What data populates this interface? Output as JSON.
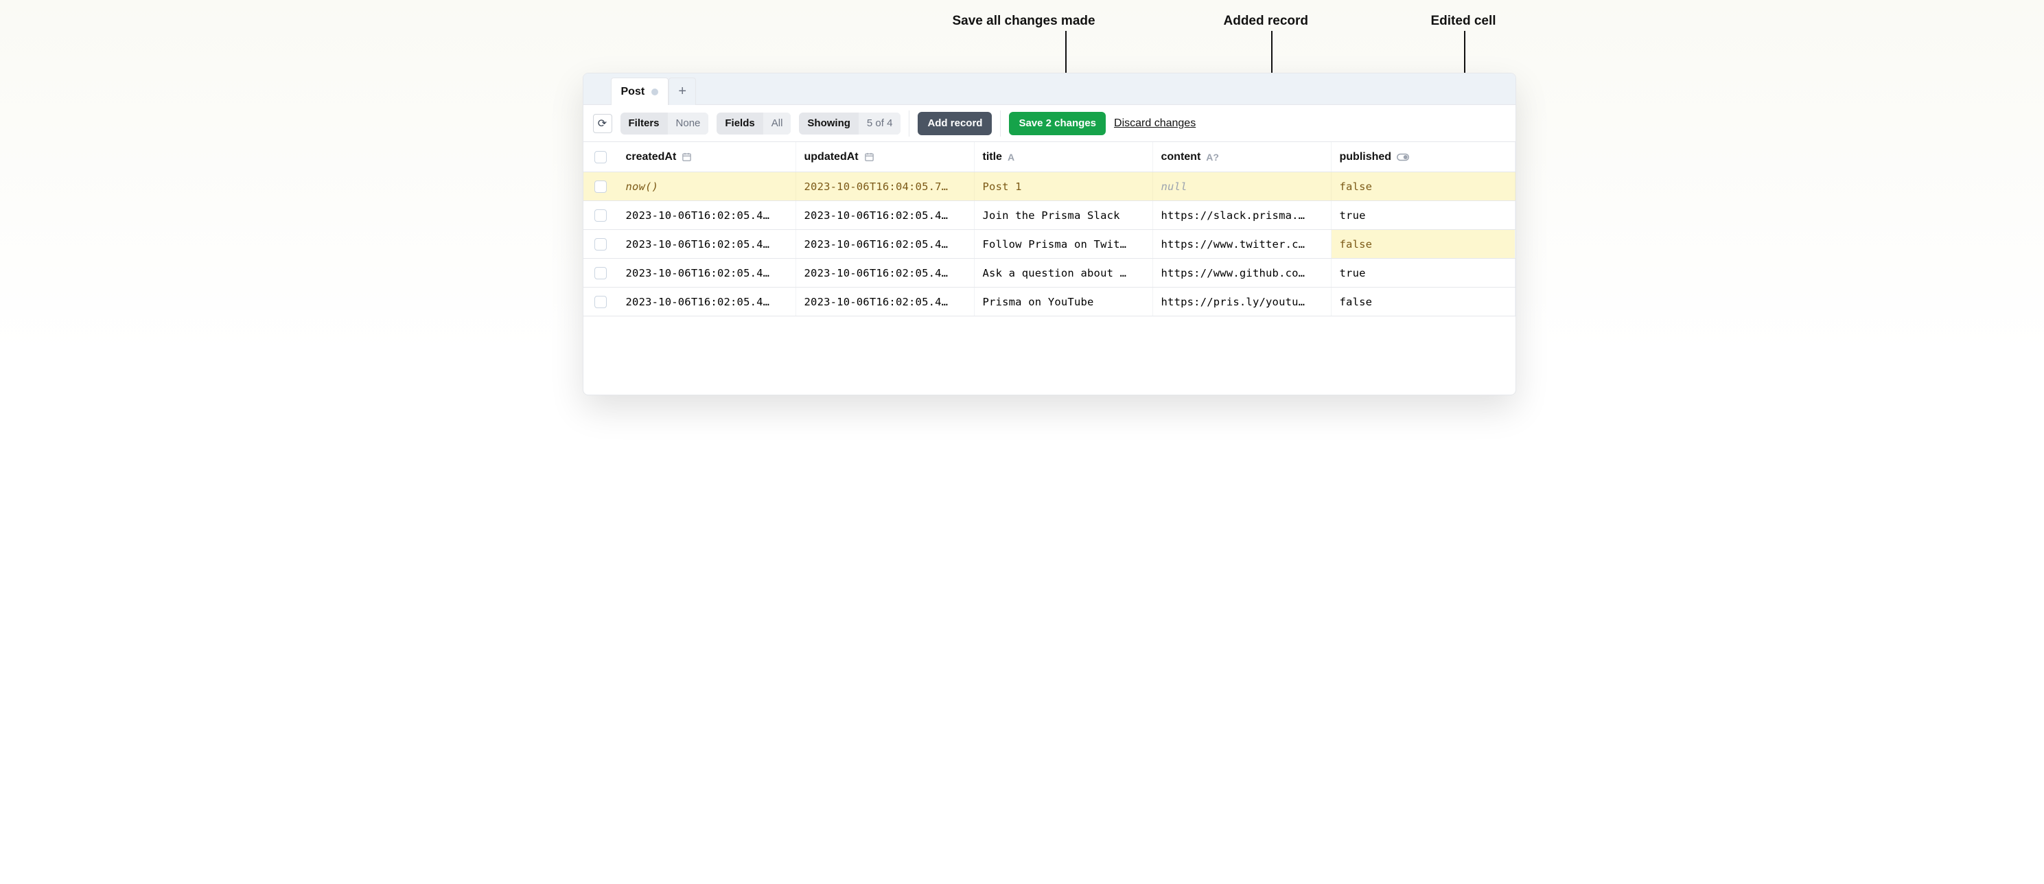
{
  "annotations": {
    "save": "Save all changes made",
    "added": "Added record",
    "edited": "Edited cell"
  },
  "tabs": {
    "active": "Post"
  },
  "toolbar": {
    "filters_label": "Filters",
    "filters_value": "None",
    "fields_label": "Fields",
    "fields_value": "All",
    "showing_label": "Showing",
    "showing_value": "5 of 4",
    "add_record": "Add record",
    "save_changes": "Save 2 changes",
    "discard": "Discard changes"
  },
  "columns": {
    "createdAt": "createdAt",
    "updatedAt": "updatedAt",
    "title": "title",
    "content": "content",
    "published": "published",
    "title_type": "A",
    "content_type": "A?"
  },
  "rows": [
    {
      "added": true,
      "createdAt": "now()",
      "createdAt_default": true,
      "updatedAt": "2023-10-06T16:04:05.7…",
      "title": "Post 1",
      "content": "null",
      "content_null": true,
      "published": "false",
      "published_edited": false
    },
    {
      "added": false,
      "createdAt": "2023-10-06T16:02:05.4…",
      "updatedAt": "2023-10-06T16:02:05.4…",
      "title": "Join the Prisma Slack",
      "content": "https://slack.prisma.…",
      "published": "true",
      "published_edited": false
    },
    {
      "added": false,
      "createdAt": "2023-10-06T16:02:05.4…",
      "updatedAt": "2023-10-06T16:02:05.4…",
      "title": "Follow Prisma on Twit…",
      "content": "https://www.twitter.c…",
      "published": "false",
      "published_edited": true
    },
    {
      "added": false,
      "createdAt": "2023-10-06T16:02:05.4…",
      "updatedAt": "2023-10-06T16:02:05.4…",
      "title": "Ask a question about …",
      "content": "https://www.github.co…",
      "published": "true",
      "published_edited": false
    },
    {
      "added": false,
      "createdAt": "2023-10-06T16:02:05.4…",
      "updatedAt": "2023-10-06T16:02:05.4…",
      "title": "Prisma on YouTube",
      "content": "https://pris.ly/youtu…",
      "published": "false",
      "published_edited": false
    }
  ]
}
